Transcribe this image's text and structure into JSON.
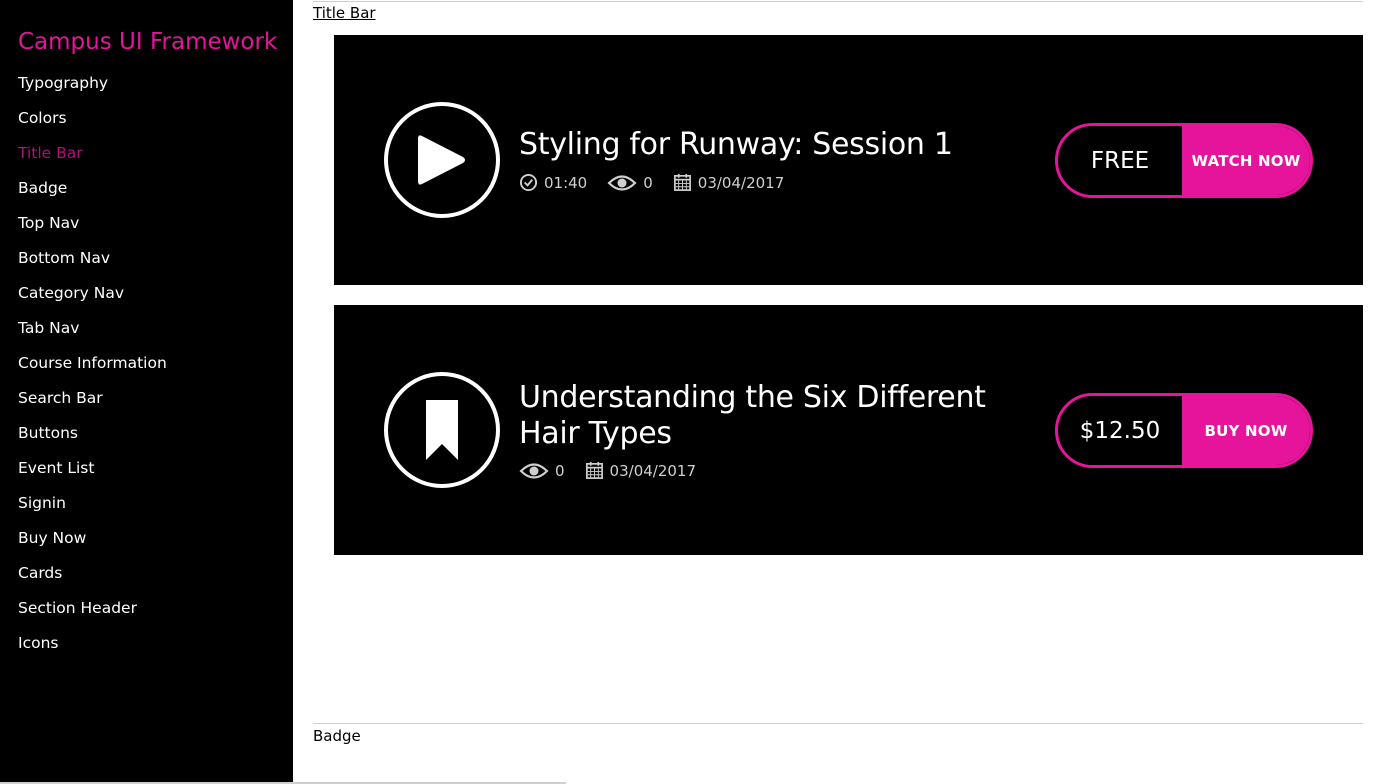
{
  "sidebar": {
    "brand": "Campus UI Framework",
    "items": [
      {
        "label": "Typography"
      },
      {
        "label": "Colors"
      },
      {
        "label": "Title Bar"
      },
      {
        "label": "Badge"
      },
      {
        "label": "Top Nav"
      },
      {
        "label": "Bottom Nav"
      },
      {
        "label": "Category Nav"
      },
      {
        "label": "Tab Nav"
      },
      {
        "label": "Course Information"
      },
      {
        "label": "Search Bar"
      },
      {
        "label": "Buttons"
      },
      {
        "label": "Event List"
      },
      {
        "label": "Signin"
      },
      {
        "label": "Buy Now"
      },
      {
        "label": "Cards"
      },
      {
        "label": "Section Header"
      },
      {
        "label": "Icons"
      }
    ],
    "active_item": "Title Bar"
  },
  "main": {
    "section_title": "Title Bar",
    "next_section_title": "Badge",
    "cards": [
      {
        "icon": "play-icon",
        "title": "Styling for Runway: Session 1",
        "duration": "01:40",
        "views": "0",
        "date": "03/04/2017",
        "price": "FREE",
        "action": "WATCH NOW"
      },
      {
        "icon": "bookmark-icon",
        "title": "Understanding the Six Different Hair Types",
        "views": "0",
        "date": "03/04/2017",
        "price": "$12.50",
        "action": "BUY NOW"
      }
    ]
  },
  "colors": {
    "accent": "#e6149a",
    "active_nav": "#b0107a",
    "card_bg": "#000000"
  }
}
